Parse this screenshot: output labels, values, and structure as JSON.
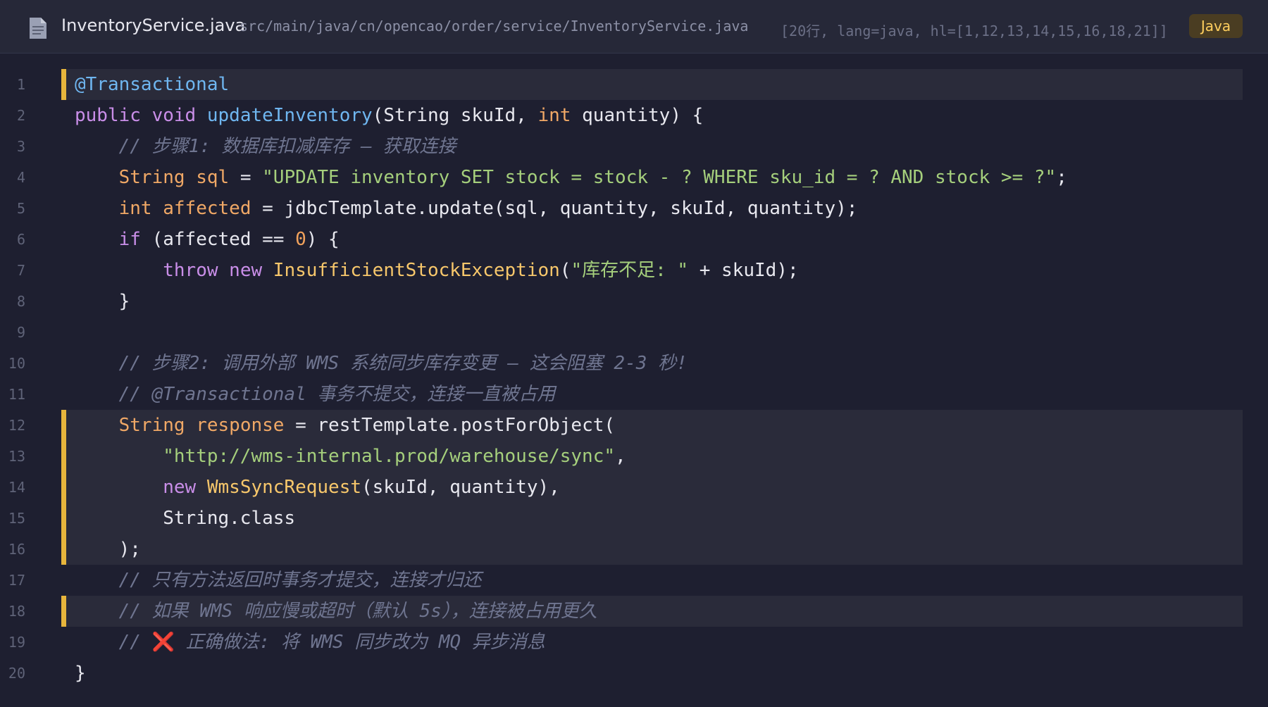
{
  "header": {
    "file_icon": "file-icon",
    "file_name": "InventoryService.java",
    "file_path": "src/main/java/cn/opencao/order/service/InventoryService.java",
    "meta": "[20行, lang=java, hl=[1,12,13,14,15,16,18,21]]",
    "lang_badge": "Java"
  },
  "colors": {
    "accent": "#e7b53c",
    "badge_text": "#ffcf5e",
    "keyword": "#c98ee8",
    "type": "#f0a866",
    "function": "#6fb6f0",
    "string": "#a5cf7c",
    "comment": "#6f7590",
    "background": "#1e1f30"
  },
  "code": {
    "highlighted_lines": [
      1,
      12,
      13,
      14,
      15,
      16,
      18
    ],
    "lines": [
      {
        "n": "1",
        "tokens": [
          {
            "t": "@Transactional",
            "c": "an"
          }
        ]
      },
      {
        "n": "2",
        "tokens": [
          {
            "t": "public",
            "c": "kw"
          },
          {
            "t": " "
          },
          {
            "t": "void",
            "c": "kw"
          },
          {
            "t": " "
          },
          {
            "t": "updateInventory",
            "c": "fn"
          },
          {
            "t": "(String skuId, "
          },
          {
            "t": "int",
            "c": "ty"
          },
          {
            "t": " quantity) {"
          }
        ]
      },
      {
        "n": "3",
        "tokens": [
          {
            "t": "    "
          },
          {
            "t": "// 步骤1: 数据库扣减库存 — 获取连接",
            "c": "cm"
          }
        ]
      },
      {
        "n": "4",
        "tokens": [
          {
            "t": "    "
          },
          {
            "t": "String",
            "c": "ty"
          },
          {
            "t": " "
          },
          {
            "t": "sql",
            "c": "ty"
          },
          {
            "t": " = "
          },
          {
            "t": "\"UPDATE inventory SET stock = stock - ? WHERE sku_id = ? AND stock >= ?\"",
            "c": "st"
          },
          {
            "t": ";"
          }
        ]
      },
      {
        "n": "5",
        "tokens": [
          {
            "t": "    "
          },
          {
            "t": "int",
            "c": "ty"
          },
          {
            "t": " "
          },
          {
            "t": "affected",
            "c": "ty"
          },
          {
            "t": " = jdbcTemplate.update(sql, quantity, skuId, quantity);"
          }
        ]
      },
      {
        "n": "6",
        "tokens": [
          {
            "t": "    "
          },
          {
            "t": "if",
            "c": "kw"
          },
          {
            "t": " (affected == "
          },
          {
            "t": "0",
            "c": "nu"
          },
          {
            "t": ") {"
          }
        ]
      },
      {
        "n": "7",
        "tokens": [
          {
            "t": "        "
          },
          {
            "t": "throw",
            "c": "kw"
          },
          {
            "t": " "
          },
          {
            "t": "new",
            "c": "kw"
          },
          {
            "t": " "
          },
          {
            "t": "InsufficientStockException",
            "c": "cl"
          },
          {
            "t": "("
          },
          {
            "t": "\"库存不足: \"",
            "c": "st"
          },
          {
            "t": " + skuId);"
          }
        ]
      },
      {
        "n": "8",
        "tokens": [
          {
            "t": "    }"
          }
        ]
      },
      {
        "n": "9",
        "tokens": []
      },
      {
        "n": "10",
        "tokens": [
          {
            "t": "    "
          },
          {
            "t": "// 步骤2: 调用外部 WMS 系统同步库存变更 — 这会阻塞 2-3 秒!",
            "c": "cm"
          }
        ]
      },
      {
        "n": "11",
        "tokens": [
          {
            "t": "    "
          },
          {
            "t": "// @Transactional 事务不提交，连接一直被占用",
            "c": "cm"
          }
        ]
      },
      {
        "n": "12",
        "tokens": [
          {
            "t": "    "
          },
          {
            "t": "String",
            "c": "ty"
          },
          {
            "t": " "
          },
          {
            "t": "response",
            "c": "ty"
          },
          {
            "t": " = restTemplate.postForObject("
          }
        ]
      },
      {
        "n": "13",
        "tokens": [
          {
            "t": "        "
          },
          {
            "t": "\"http://wms-internal.prod/warehouse/sync\"",
            "c": "st"
          },
          {
            "t": ","
          }
        ]
      },
      {
        "n": "14",
        "tokens": [
          {
            "t": "        "
          },
          {
            "t": "new",
            "c": "kw"
          },
          {
            "t": " "
          },
          {
            "t": "WmsSyncRequest",
            "c": "cl"
          },
          {
            "t": "(skuId, quantity),"
          }
        ]
      },
      {
        "n": "15",
        "tokens": [
          {
            "t": "        String.class"
          }
        ]
      },
      {
        "n": "16",
        "tokens": [
          {
            "t": "    );"
          }
        ]
      },
      {
        "n": "17",
        "tokens": [
          {
            "t": "    "
          },
          {
            "t": "// 只有方法返回时事务才提交，连接才归还",
            "c": "cm"
          }
        ]
      },
      {
        "n": "18",
        "tokens": [
          {
            "t": "    "
          },
          {
            "t": "// 如果 WMS 响应慢或超时（默认 5s），连接被占用更久",
            "c": "cm"
          }
        ]
      },
      {
        "n": "19",
        "tokens": [
          {
            "t": "    "
          },
          {
            "t": "// ",
            "c": "cm"
          },
          {
            "t": "❌",
            "c": "em"
          },
          {
            "t": " 正确做法: 将 WMS 同步改为 MQ 异步消息",
            "c": "cm"
          }
        ]
      },
      {
        "n": "20",
        "tokens": [
          {
            "t": "}"
          }
        ]
      }
    ]
  }
}
